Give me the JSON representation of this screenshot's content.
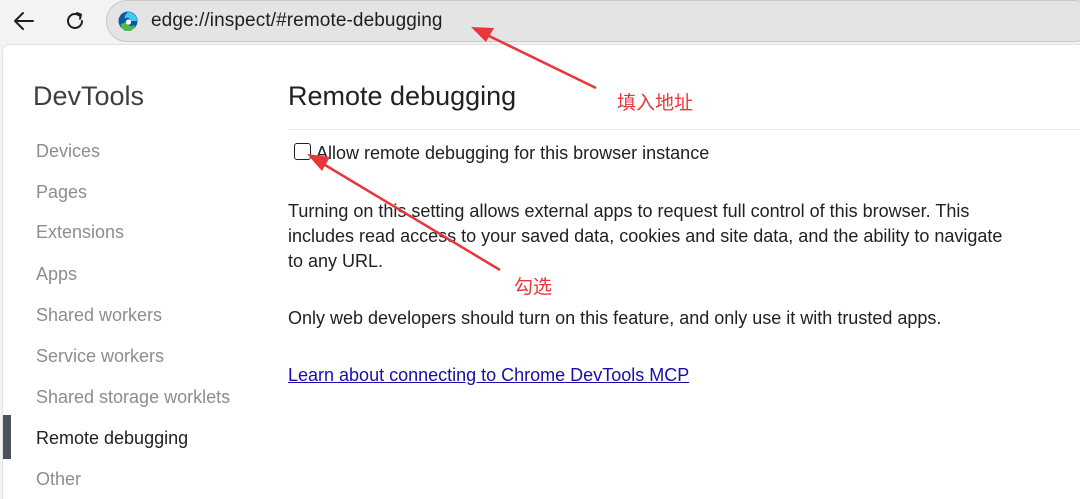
{
  "browser": {
    "url": "edge://inspect/#remote-debugging"
  },
  "sidebar": {
    "brand": "DevTools",
    "items": [
      {
        "label": "Devices"
      },
      {
        "label": "Pages"
      },
      {
        "label": "Extensions"
      },
      {
        "label": "Apps"
      },
      {
        "label": "Shared workers"
      },
      {
        "label": "Service workers"
      },
      {
        "label": "Shared storage worklets"
      },
      {
        "label": "Remote debugging"
      },
      {
        "label": "Other"
      }
    ],
    "active": "Remote debugging"
  },
  "main": {
    "title": "Remote debugging",
    "checkbox_label": "Allow remote debugging for this browser instance",
    "checkbox_checked": false,
    "description": "Turning on this setting allows external apps to request full control of this browser. This includes read access to your saved data, cookies and site data, and the ability to navigate to any URL.",
    "note": "Only web developers should turn on this feature, and only use it with trusted apps.",
    "link": "Learn about connecting to Chrome DevTools MCP"
  },
  "annotations": {
    "address_hint": "填入地址",
    "checkbox_hint": "勾选",
    "color": "#e8363b"
  }
}
